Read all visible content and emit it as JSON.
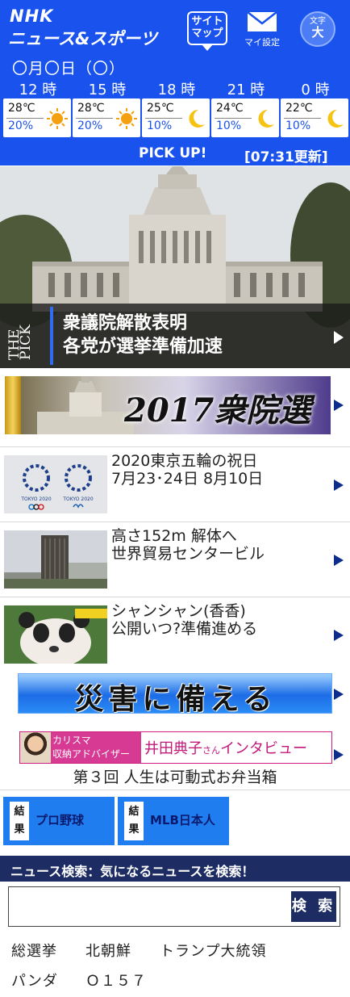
{
  "header": {
    "logo_top": "NHK",
    "logo_bottom": "ニュース&スポーツ",
    "sitemap": [
      "サイト",
      "マップ"
    ],
    "settings": "マイ設定",
    "text_size": [
      "文字",
      "大"
    ],
    "date": "〇月〇日（〇）",
    "hours": [
      "12 時",
      "15 時",
      "18 時",
      "21 時",
      "0 時"
    ],
    "forecast": [
      {
        "temp": "28℃",
        "pct": "20%",
        "icon": "sun-icon"
      },
      {
        "temp": "28℃",
        "pct": "20%",
        "icon": "sun-icon"
      },
      {
        "temp": "25℃",
        "pct": "10%",
        "icon": "moon-icon"
      },
      {
        "temp": "24℃",
        "pct": "10%",
        "icon": "moon-icon"
      },
      {
        "temp": "22℃",
        "pct": "10%",
        "icon": "moon-icon"
      }
    ],
    "pick_up": "PICK UP!",
    "updated": "[07:31更新]"
  },
  "hero": {
    "badge": [
      "THE",
      "PICK"
    ],
    "line1": "衆議院解散表明",
    "line2": "各党が選挙準備加速"
  },
  "election": {
    "title": "2017衆院選"
  },
  "news": [
    {
      "line1": "2020東京五輪の祝日",
      "line2": "7月23･24日 8月10日",
      "thumb_text": [
        "TOKYO 2020",
        "TOKYO 2020"
      ]
    },
    {
      "line1": "高さ152m 解体へ",
      "line2": "世界貿易センタービル"
    },
    {
      "line1": "シャンシャン(香香)",
      "line2": "公開いつ?準備進める"
    }
  ],
  "disaster": {
    "title": "災害に備える"
  },
  "interview": {
    "role1": "カリスマ",
    "role2": "収納アドバイザー",
    "name": "井田典子",
    "honorific": "さん",
    "label": "インタビュー",
    "subtitle": "第３回 人生は可動式お弁当箱"
  },
  "scores": [
    {
      "tag": [
        "結",
        "果"
      ],
      "label": "プロ野球"
    },
    {
      "tag": [
        "結",
        "果"
      ],
      "label": "MLB日本人"
    }
  ],
  "search": {
    "heading": "ニュース検索：気になるニュースを検索！",
    "value": "",
    "placeholder": "",
    "button": "検 索"
  },
  "keywords": [
    "総選挙",
    "北朝鮮",
    "トランプ大統領",
    "パンダ",
    "Ｏ１５７"
  ],
  "colors": {
    "header_blue": "#1a52ee",
    "search_navy": "#1d2d63",
    "accent_blue": "#1f7df0",
    "interview_pink": "#d63a93"
  }
}
